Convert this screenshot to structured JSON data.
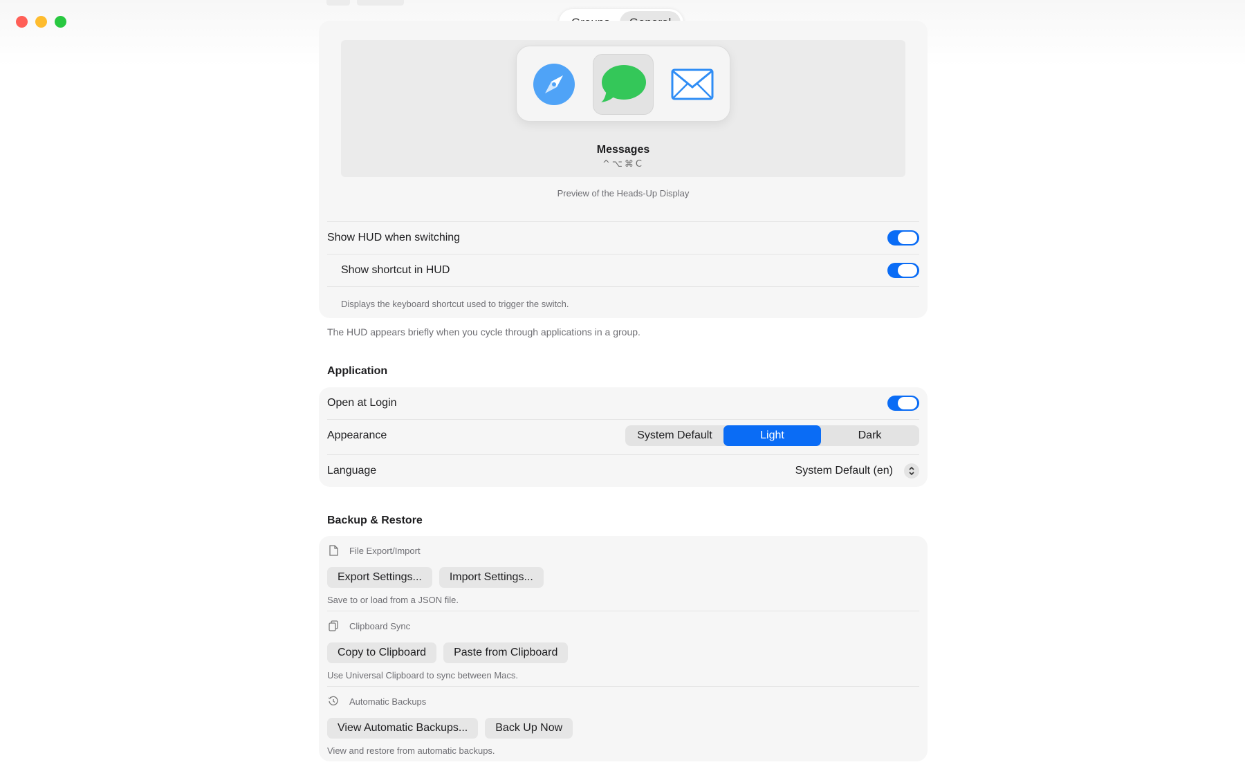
{
  "window": {
    "traffic_lights": [
      "close",
      "minimize",
      "zoom"
    ]
  },
  "top_tabs": [
    {
      "label": "Groups",
      "active": false
    },
    {
      "label": "General",
      "active": true
    }
  ],
  "hud_preview": {
    "apps": [
      {
        "name": "Safari",
        "icon": "compass-icon",
        "selected": false
      },
      {
        "name": "Messages",
        "icon": "message-bubble-icon",
        "selected": true
      },
      {
        "name": "Mail",
        "icon": "envelope-icon",
        "selected": false
      }
    ],
    "selected_app_name": "Messages",
    "selected_shortcut": "^⌥⌘C",
    "caption": "Preview of the Heads-Up Display"
  },
  "hud_settings": {
    "show_hud_label": "Show HUD when switching",
    "show_hud_on": true,
    "show_shortcut_label": "Show shortcut in HUD",
    "show_shortcut_on": true,
    "show_shortcut_note": "Displays the keyboard shortcut used to trigger the switch.",
    "section_note": "The HUD appears briefly when you cycle through applications in a group."
  },
  "application": {
    "title": "Application",
    "open_at_login_label": "Open at Login",
    "open_at_login_on": true,
    "appearance_label": "Appearance",
    "appearance_options": [
      "System Default",
      "Light",
      "Dark"
    ],
    "appearance_selected": "Light",
    "language_label": "Language",
    "language_value": "System Default (en)"
  },
  "backup": {
    "title": "Backup & Restore",
    "groups": [
      {
        "title": "File Export/Import",
        "icon": "document-icon",
        "buttons": [
          "Export Settings...",
          "Import Settings..."
        ],
        "note": "Save to or load from a JSON file."
      },
      {
        "title": "Clipboard Sync",
        "icon": "clipboard-icon",
        "buttons": [
          "Copy to Clipboard",
          "Paste from Clipboard"
        ],
        "note": "Use Universal Clipboard to sync between Macs."
      },
      {
        "title": "Automatic Backups",
        "icon": "history-clock-icon",
        "buttons": [
          "View Automatic Backups...",
          "Back Up Now"
        ],
        "note": "View and restore from automatic backups."
      }
    ]
  },
  "colors": {
    "accent": "#0a6cf5",
    "messages_green": "#34c759",
    "safari_blue": "#4fa3f7",
    "mail_blue": "#2f8df5",
    "card_bg": "#f6f6f6"
  }
}
